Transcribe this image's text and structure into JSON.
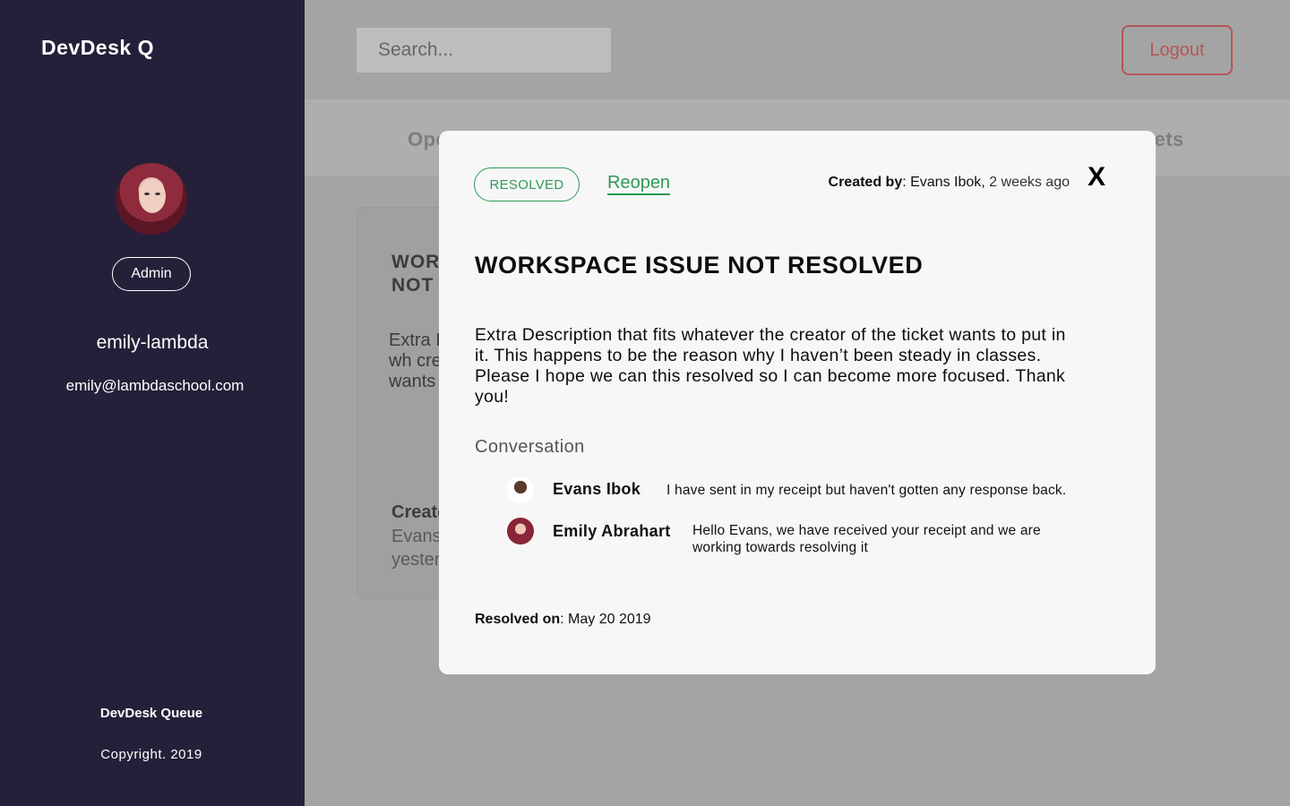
{
  "sidebar": {
    "brand": "DevDesk Q",
    "role": "Admin",
    "username": "emily-lambda",
    "email": "emily@lambdaschool.com",
    "footer_title": "DevDesk Queue",
    "footer_copy": "Copyright. 2019"
  },
  "header": {
    "search_placeholder": "Search...",
    "logout_label": "Logout"
  },
  "tabs": [
    "Ope",
    "ckets"
  ],
  "card": {
    "title": "WORK NOT I",
    "desc": "Extra I fits wh creato wants This h",
    "created_label": "Create",
    "meta": "Evans yester"
  },
  "modal": {
    "status": "RESOLVED",
    "reopen_label": "Reopen",
    "created_by_label": "Created by",
    "created_by": ": Evans Ibok,",
    "created_when": " 2 weeks ago",
    "close_label": "X",
    "title": "WORKSPACE ISSUE NOT RESOLVED",
    "description": "Extra Description that fits whatever the creator of the ticket wants to put in it. This happens to be the reason why I haven’t been steady in classes. Please I hope we can this resolved so I can become more focused. Thank you!",
    "conversation_label": "Conversation",
    "messages": [
      {
        "author": "Evans Ibok",
        "text": "I have sent in my receipt but haven't gotten any response back."
      },
      {
        "author": "Emily Abrahart",
        "text": "Hello Evans, we have received your receipt and we are working towards resolving it"
      }
    ],
    "resolved_label": "Resolved on",
    "resolved_value": ": May 20 2019"
  }
}
